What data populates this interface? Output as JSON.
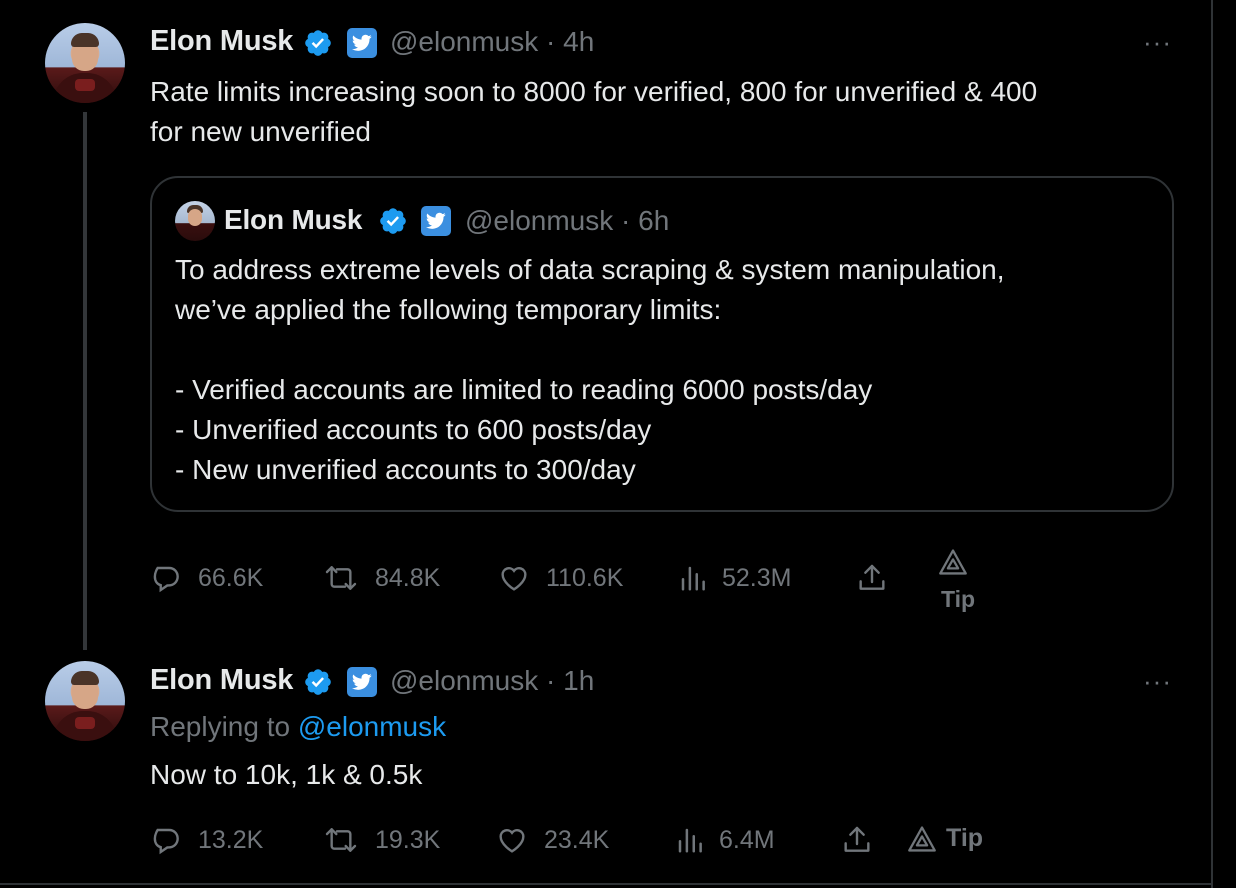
{
  "main_tweet": {
    "author_name": "Elon Musk",
    "handle": "@elonmusk",
    "time": "· 4h",
    "text": "Rate limits increasing soon to 8000 for verified, 800 for unverified & 400\nfor new unverified",
    "more_label": "···",
    "quoted_tweet": {
      "author_name": "Elon Musk",
      "handle": "@elonmusk",
      "time": "· 6h",
      "text": "To address extreme levels of data scraping & system manipulation,\nwe’ve applied the following temporary limits:\n\n- Verified accounts are limited to reading 6000 posts/day\n- Unverified accounts to 600 posts/day\n- New unverified accounts to 300/day"
    },
    "actions": {
      "replies": "66.6K",
      "reposts": "84.8K",
      "likes": "110.6K",
      "views": "52.3M",
      "tip_label": "Tip"
    }
  },
  "reply_tweet": {
    "author_name": "Elon Musk",
    "handle": "@elonmusk",
    "time": "· 1h",
    "replying_to_label": "Replying to",
    "replying_to_handle": "@elonmusk",
    "text": "Now to 10k, 1k & 0.5k",
    "more_label": "···",
    "actions": {
      "replies": "13.2K",
      "reposts": "19.3K",
      "likes": "23.4K",
      "views": "6.4M",
      "tip_label": "Tip"
    }
  },
  "icons": {
    "verified": "verified-badge-icon",
    "twitter_affiliate": "twitter-bird-badge-icon",
    "reply": "reply-bubble-icon",
    "repost": "repost-arrows-icon",
    "like": "heart-icon",
    "views": "views-bars-icon",
    "share": "share-upload-icon",
    "tip": "tip-triangle-icon"
  },
  "colors": {
    "background": "#000000",
    "text": "#e7e9ea",
    "secondary": "#71767b",
    "accent": "#1d9bf0",
    "border": "#2f3336"
  }
}
